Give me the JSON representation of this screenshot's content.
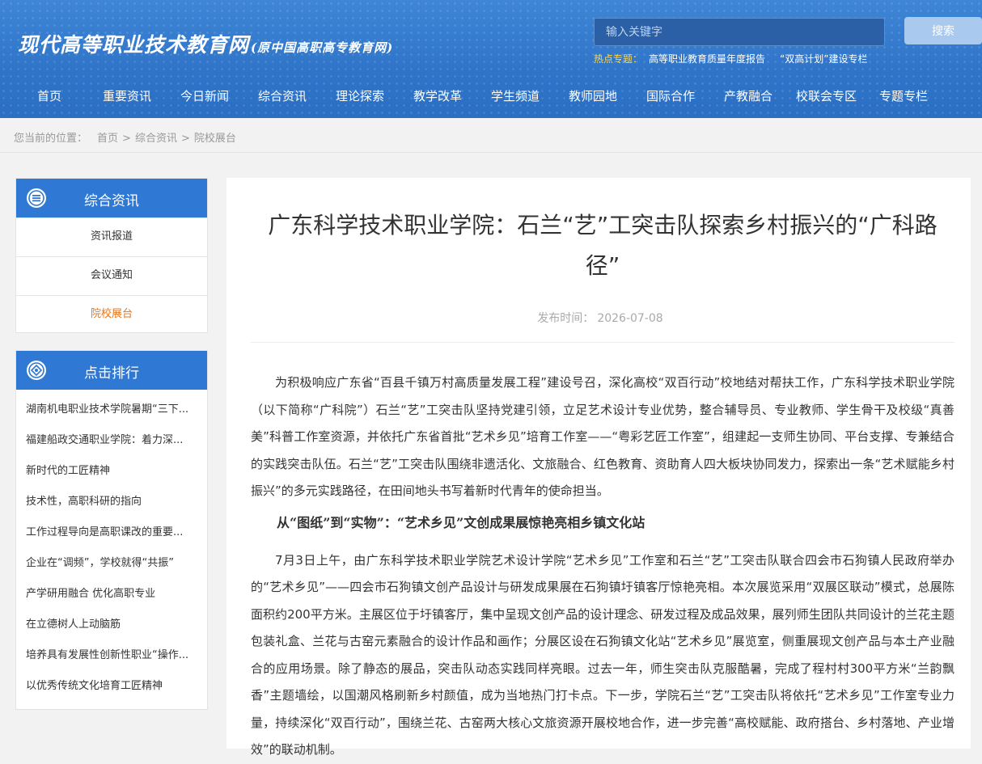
{
  "header": {
    "logo": "现代高等职业技术教育网",
    "logo_sub": "(原中国高职高专教育网)",
    "search_placeholder": "输入关键字",
    "search_button": "搜索",
    "hot_label": "热点专题：",
    "hot_links": [
      "高等职业教育质量年度报告",
      "“双高计划”建设专栏"
    ]
  },
  "nav": [
    "首页",
    "重要资讯",
    "今日新闻",
    "综合资讯",
    "理论探索",
    "教学改革",
    "学生频道",
    "教师园地",
    "国际合作",
    "产教融合",
    "校联会专区",
    "专题专栏"
  ],
  "breadcrumb": {
    "label": "您当前的位置：",
    "items": [
      "首页",
      "综合资讯",
      "院校展台"
    ],
    "sep": ">"
  },
  "sidebar": {
    "section_title": "综合资讯",
    "items": [
      {
        "label": "资讯报道",
        "active": false
      },
      {
        "label": "会议通知",
        "active": false
      },
      {
        "label": "院校展台",
        "active": true
      }
    ],
    "ranking_title": "点击排行",
    "ranking": [
      "湖南机电职业技术学院暑期“三下...",
      "福建船政交通职业学院：着力深...",
      "新时代的工匠精神",
      "技术性，高职科研的指向",
      "工作过程导向是高职课改的重要...",
      "企业在“调频”，学校就得“共振”",
      "产学研用融合 优化高职专业",
      "在立德树人上动脑筋",
      "培养具有发展性创新性职业“操作...",
      "以优秀传统文化培育工匠精神"
    ]
  },
  "article": {
    "title": "广东科学技术职业学院：石兰“艺”工突击队探索乡村振兴的“广科路径”",
    "date_label": "发布时间：",
    "date": "2026-07-08",
    "para1": "为积极响应广东省“百县千镇万村高质量发展工程”建设号召，深化高校“双百行动”校地结对帮扶工作，广东科学技术职业学院（以下简称“广科院”）石兰“艺”工突击队坚持党建引领，立足艺术设计专业优势，整合辅导员、专业教师、学生骨干及校级“真善美”科普工作室资源，并依托广东省首批“艺术乡见”培育工作室——“粤彩艺匠工作室”，组建起一支师生协同、平台支撑、专兼结合的实践突击队伍。石兰“艺”工突击队围绕非遗活化、文旅融合、红色教育、资助育人四大板块协同发力，探索出一条“艺术赋能乡村振兴”的多元实践路径，在田间地头书写着新时代青年的使命担当。",
    "subheading": "从“图纸”到“实物”：“艺术乡见”文创成果展惊艳亮相乡镇文化站",
    "para2": "7月3日上午，由广东科学技术职业学院艺术设计学院“艺术乡见”工作室和石兰“艺”工突击队联合四会市石狗镇人民政府举办的“艺术乡见”——四会市石狗镇文创产品设计与研发成果展在石狗镇圩镇客厅惊艳亮相。本次展览采用“双展区联动”模式，总展陈面积约200平方米。主展区位于圩镇客厅，集中呈现文创产品的设计理念、研发过程及成品效果，展列师生团队共同设计的兰花主题包装礼盒、兰花与古窑元素融合的设计作品和画作；分展区设在石狗镇文化站“艺术乡见”展览室，侧重展现文创产品与本土产业融合的应用场景。除了静态的展品，突击队动态实践同样亮眼。过去一年，师生突击队克服酷暑，完成了程村村300平方米“兰韵飘香”主题墙绘，以国潮风格刷新乡村颜值，成为当地热门打卡点。下一步，学院石兰“艺”工突击队将依托“艺术乡见”工作室专业力量，持续深化“双百行动”，围绕兰花、古窑两大核心文旅资源开展校地合作，进一步完善“高校赋能、政府搭台、乡村落地、产业增效”的联动机制。"
  }
}
